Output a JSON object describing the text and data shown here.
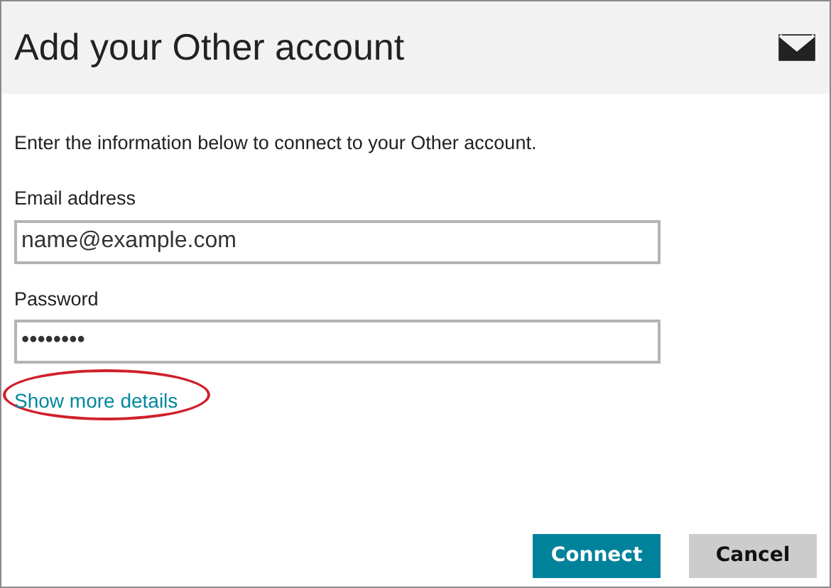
{
  "header": {
    "title": "Add your Other account"
  },
  "instructions": "Enter the information below to connect to your Other account.",
  "fields": [
    {
      "label": "Email address",
      "value": "name@example.com"
    },
    {
      "label": "Password",
      "value": "••••••••"
    }
  ],
  "link": {
    "text": "Show more details",
    "highlighted": true
  },
  "buttons": [
    {
      "label": "Connect",
      "kind": "primary"
    },
    {
      "label": "Cancel",
      "kind": "secondary"
    }
  ]
}
